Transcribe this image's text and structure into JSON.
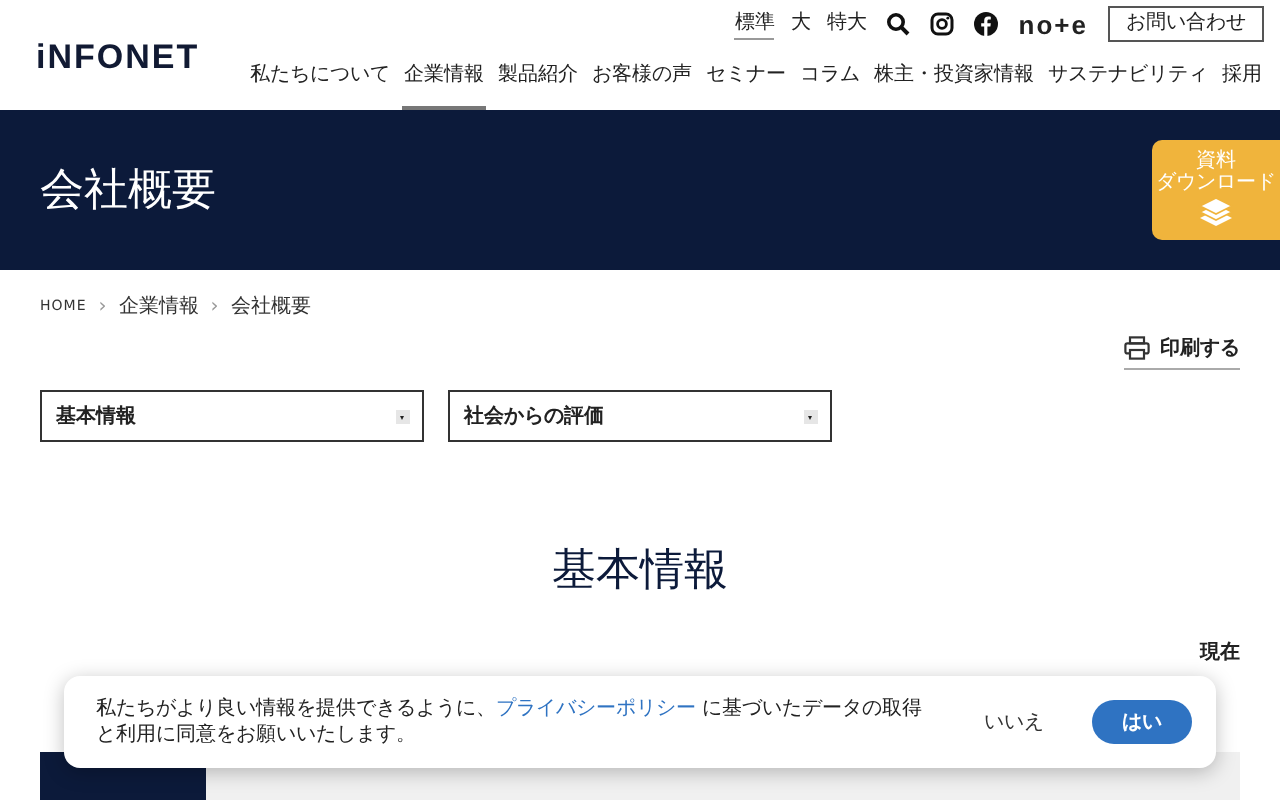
{
  "header": {
    "logo": "iNFONET",
    "font_sizes": [
      {
        "label": "標準",
        "selected": true
      },
      {
        "label": "大",
        "selected": false
      },
      {
        "label": "特大",
        "selected": false
      }
    ],
    "note_logo": "no+e",
    "contact_button": "お問い合わせ",
    "nav": [
      {
        "label": "私たちについて",
        "selected": false
      },
      {
        "label": "企業情報",
        "selected": true
      },
      {
        "label": "製品紹介",
        "selected": false
      },
      {
        "label": "お客様の声",
        "selected": false
      },
      {
        "label": "セミナー",
        "selected": false
      },
      {
        "label": "コラム",
        "selected": false
      },
      {
        "label": "株主・投資家情報",
        "selected": false
      },
      {
        "label": "サステナビリティ",
        "selected": false
      },
      {
        "label": "採用",
        "selected": false
      }
    ]
  },
  "banner": {
    "title": "会社概要",
    "download_button": [
      "資料",
      "ダウンロード"
    ]
  },
  "breadcrumb": [
    {
      "label": "HOME"
    },
    {
      "label": "企業情報"
    },
    {
      "label": "会社概要"
    }
  ],
  "breadcrumb_separator": "›",
  "print_link": "印刷する",
  "selects": [
    {
      "value": "基本情報"
    },
    {
      "value": "社会からの評価"
    }
  ],
  "section_title": "基本情報",
  "date_note": "現在",
  "cookie_banner": {
    "text_before": "私たちがより良い情報を提供できるように、",
    "link": "プライバシーポリシー",
    "text_after": " に基づいたデータの取得と利用に同意をお願いいたします。",
    "decline": "いいえ",
    "accept": "はい"
  }
}
